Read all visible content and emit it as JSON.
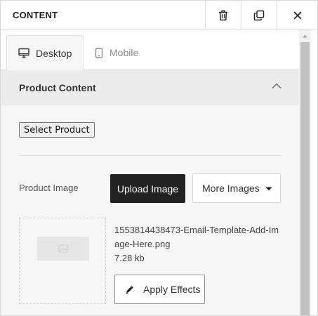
{
  "header": {
    "title": "CONTENT",
    "icons": {
      "trash": "trash-icon",
      "duplicate": "duplicate-icon",
      "close": "close-icon"
    }
  },
  "tabs": [
    {
      "label": "Desktop",
      "icon": "desktop-icon",
      "active": true
    },
    {
      "label": "Mobile",
      "icon": "mobile-icon",
      "active": false
    }
  ],
  "section": {
    "title": "Product Content",
    "expanded": true,
    "icon": "chevron-up-icon"
  },
  "select_product": {
    "label": "Select Product"
  },
  "product_image": {
    "label": "Product Image",
    "upload_label": "Upload Image",
    "more_label": "More Images",
    "file_name": "1553814438473-Email-Template-Add-Image-Here.png",
    "file_size": "7.28 kb",
    "effects_label": "Apply Effects"
  },
  "colors": {
    "primary_button": "#222222",
    "section_bg": "#ececec",
    "panel_bg": "#f6f6f6"
  }
}
